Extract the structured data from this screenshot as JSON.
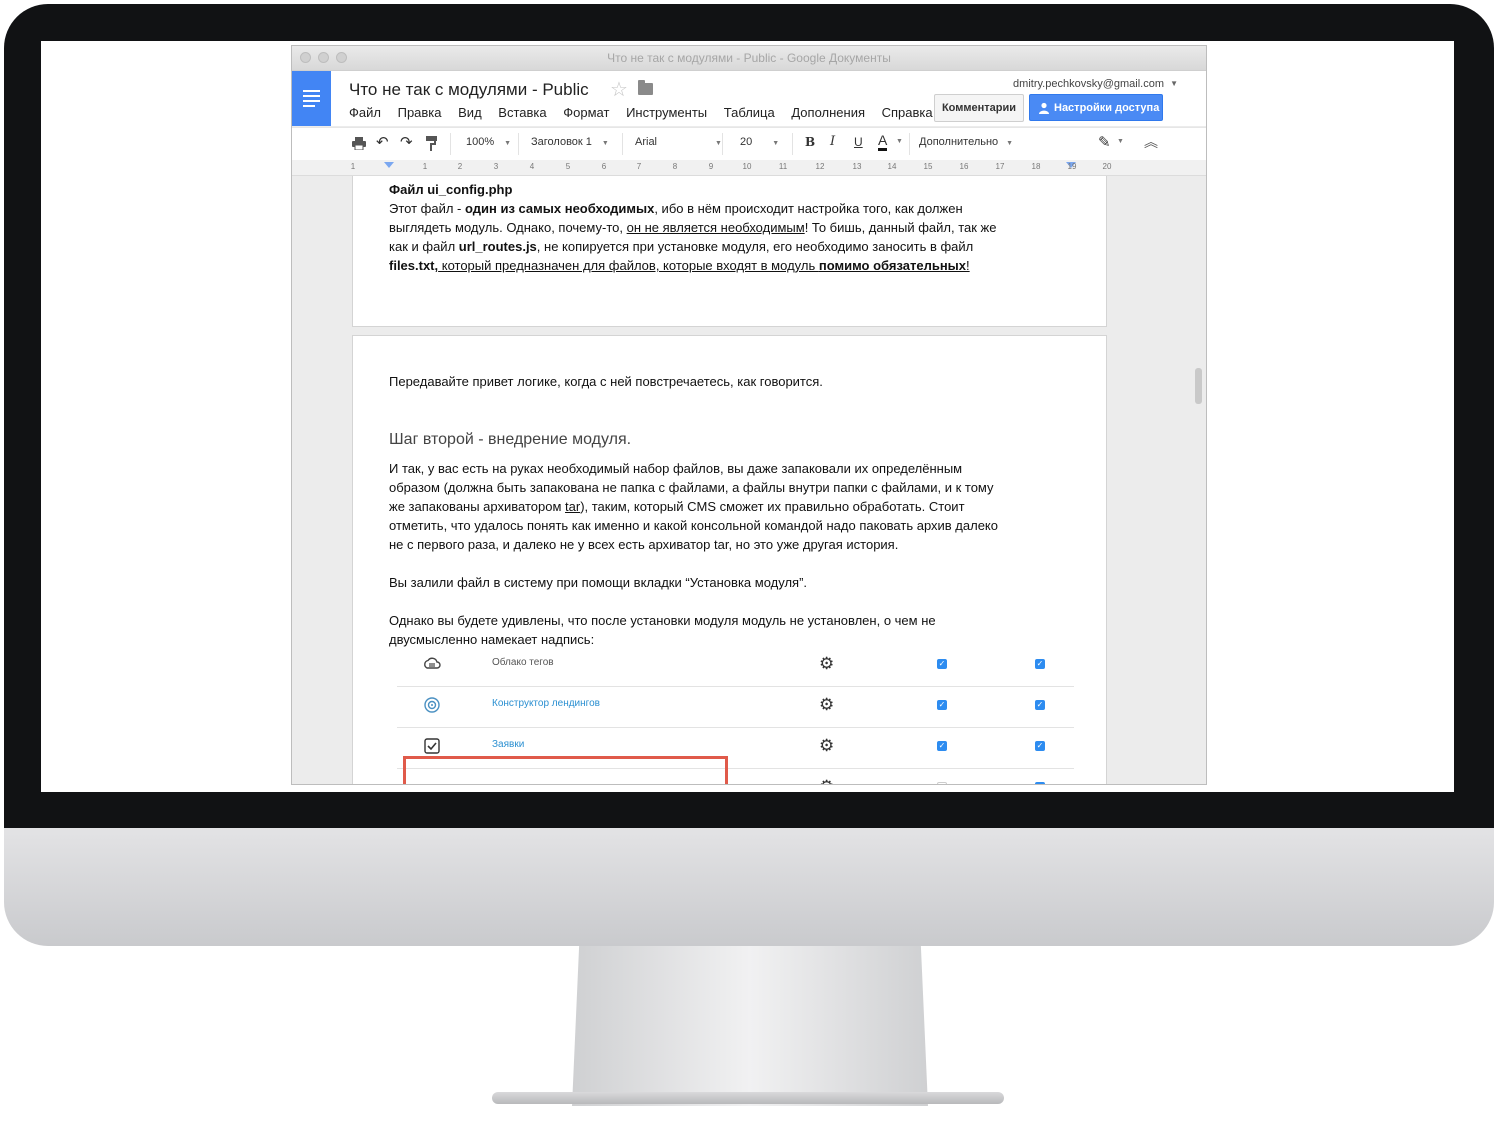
{
  "window": {
    "titlebar": "Что не так с модулями - Public - Google Документы"
  },
  "header": {
    "doc_title": "Что не так с модулями - Public",
    "user_email": "dmitry.pechkovsky@gmail.com",
    "comments_label": "Комментарии",
    "share_label": "Настройки доступа",
    "menu": [
      "Файл",
      "Правка",
      "Вид",
      "Вставка",
      "Формат",
      "Инструменты",
      "Таблица",
      "Дополнения",
      "Справка"
    ]
  },
  "toolbar": {
    "zoom": "100%",
    "style": "Заголовок 1",
    "font": "Arial",
    "size": "20",
    "bold": "B",
    "italic": "I",
    "underline": "U",
    "text_color": "A",
    "more": "Дополнительно"
  },
  "ruler": {
    "numbers": [
      "1",
      "1",
      "2",
      "3",
      "4",
      "5",
      "6",
      "7",
      "8",
      "9",
      "10",
      "11",
      "12",
      "13",
      "14",
      "15",
      "16",
      "17",
      "18",
      "19",
      "20"
    ]
  },
  "page1": {
    "heading": "Файл ui_config.php",
    "l1_a": "Этот файл - ",
    "l1_b": "один из самых необходимых",
    "l1_c": ", ибо в нём происходит настройка того, как должен",
    "l2_a": "выглядеть модуль. Однако, почему-то, ",
    "l2_b": "он не является необходимым",
    "l2_c": "! То бишь, данный файл, так же",
    "l3_a": "как и файл ",
    "l3_b": "url_routes.js",
    "l3_c": ", не копируется при установке модуля, его необходимо заносить в файл",
    "l4_a": "files.txt,",
    "l4_b": " который предназначен для файлов, которые входят в модуль ",
    "l4_c": "помимо обязательных",
    "l4_d": "!"
  },
  "page2": {
    "p1": "Передавайте привет логике, когда с ней повстречаетесь, как говорится.",
    "heading": "Шаг второй - внедрение модуля.",
    "p2_l1": "И так, у вас есть на руках необходимый набор файлов, вы даже запаковали их определённым",
    "p2_l2": "образом (должна быть запакована не папка с файлами, а файлы внутри папки с файлами, и к тому",
    "p2_l3_a": "же запакованы архиватором ",
    "p2_l3_b": "tar",
    "p2_l3_c": "), таким, который CMS сможет их правильно обработать. Стоит",
    "p2_l4": "отметить, что удалось понять как именно и какой консольной командой надо паковать архив далеко",
    "p2_l5": "не с первого раза, и далеко не у всех есть архиватор tar, но это уже другая история.",
    "p3": "Вы залили файл в систему при помощи вкладки “Установка модуля”.",
    "p4_l1": "Однако вы будете удивлены, что после установки модуля модуль не установлен, о чем не",
    "p4_l2": "двусмысленно намекает надпись:"
  },
  "modules": [
    {
      "name": "Облако тегов",
      "icon": "cloud-icon",
      "link": false
    },
    {
      "name": "Конструктор лендингов",
      "icon": "target-icon",
      "link": true
    },
    {
      "name": "Заявки",
      "icon": "checkbox-icon",
      "link": true
    }
  ],
  "colors": {
    "accent": "#4285f4",
    "share_button": "#4a8af4",
    "link": "#2a8fd1",
    "highlight_box": "#e05a4a"
  }
}
